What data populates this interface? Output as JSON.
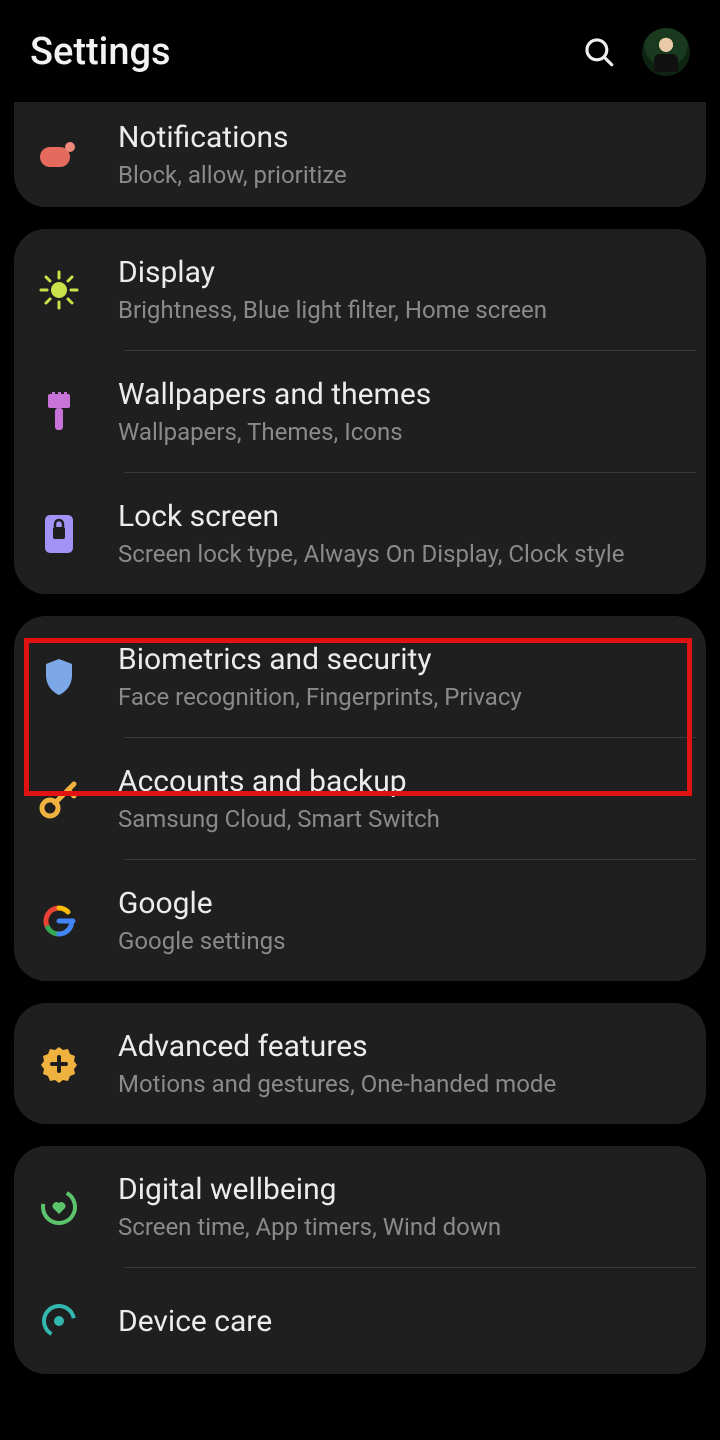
{
  "header": {
    "title": "Settings"
  },
  "groups": [
    {
      "rows": [
        {
          "id": "notifications",
          "title": "Notifications",
          "subtitle": "Block, allow, prioritize",
          "icon": "notifications-icon",
          "color": "#e46a5e"
        }
      ]
    },
    {
      "rows": [
        {
          "id": "display",
          "title": "Display",
          "subtitle": "Brightness, Blue light filter, Home screen",
          "icon": "sun-icon",
          "color": "#c9e24a"
        },
        {
          "id": "wallpapers",
          "title": "Wallpapers and themes",
          "subtitle": "Wallpapers, Themes, Icons",
          "icon": "brush-icon",
          "color": "#c873d8"
        },
        {
          "id": "lockscreen",
          "title": "Lock screen",
          "subtitle": "Screen lock type, Always On Display, Clock style",
          "icon": "lock-icon",
          "color": "#a493f7"
        }
      ]
    },
    {
      "rows": [
        {
          "id": "biometrics",
          "title": "Biometrics and security",
          "subtitle": "Face recognition, Fingerprints, Privacy",
          "icon": "shield-icon",
          "color": "#7da8e8",
          "highlighted": true
        },
        {
          "id": "accounts",
          "title": "Accounts and backup",
          "subtitle": "Samsung Cloud, Smart Switch",
          "icon": "key-icon",
          "color": "#f0b23e"
        },
        {
          "id": "google",
          "title": "Google",
          "subtitle": "Google settings",
          "icon": "google-icon",
          "color": "#4a8af4"
        }
      ]
    },
    {
      "rows": [
        {
          "id": "advanced",
          "title": "Advanced features",
          "subtitle": "Motions and gestures, One-handed mode",
          "icon": "gear-plus-icon",
          "color": "#f0b23e"
        }
      ]
    },
    {
      "rows": [
        {
          "id": "wellbeing",
          "title": "Digital wellbeing",
          "subtitle": "Screen time, App timers, Wind down",
          "icon": "wellbeing-icon",
          "color": "#5bc46c"
        },
        {
          "id": "devicecare",
          "title": "Device care",
          "subtitle": "",
          "icon": "devicecare-icon",
          "color": "#33b8b0"
        }
      ]
    }
  ]
}
